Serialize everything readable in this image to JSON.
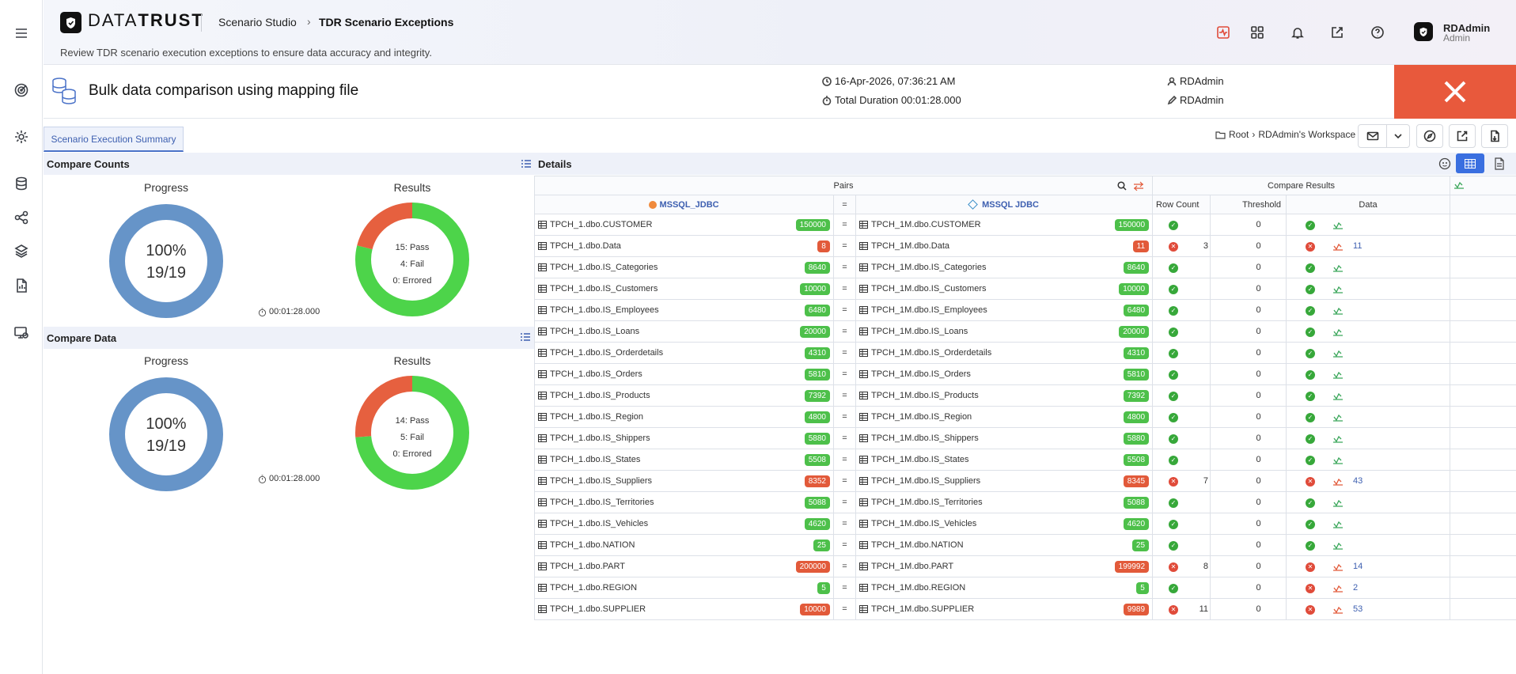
{
  "app": {
    "brand_light": "DATA",
    "brand_bold": "TRUST",
    "breadcrumb": [
      "Scenario Studio",
      "TDR Scenario Exceptions"
    ],
    "subtitle": "Review TDR scenario execution exceptions to ensure data accuracy and integrity.",
    "user": {
      "name": "RDAdmin",
      "role": "Admin"
    }
  },
  "rail_icons": [
    "menu-icon",
    "target-icon",
    "settings-icon",
    "database-icon",
    "workflow-icon",
    "layers-icon",
    "report-icon",
    "monitor-icon"
  ],
  "scenario": {
    "title": "Bulk data comparison using mapping file",
    "datetime": "16-Apr-2026, 07:36:21 AM",
    "duration": "Total Duration 00:01:28.000",
    "run_by": "RDAdmin",
    "edited_by": "RDAdmin",
    "status_color": "#e8593c"
  },
  "tab": {
    "label": "Scenario Execution Summary"
  },
  "workspace": {
    "root": "Root",
    "name": "RDAdmin's Workspace"
  },
  "compare_counts": {
    "title": "Compare Counts",
    "progress_label": "Progress",
    "results_label": "Results",
    "percent": "100%",
    "ratio": "19/19",
    "pass": "15: Pass",
    "fail": "4: Fail",
    "errored": "0: Errored",
    "pass_n": 15,
    "fail_n": 4,
    "err_n": 0,
    "duration": "00:01:28.000"
  },
  "compare_data": {
    "title": "Compare Data",
    "progress_label": "Progress",
    "results_label": "Results",
    "percent": "100%",
    "ratio": "19/19",
    "pass": "14: Pass",
    "fail": "5: Fail",
    "errored": "0: Errored",
    "pass_n": 14,
    "fail_n": 5,
    "err_n": 0,
    "duration": "00:01:28.000"
  },
  "details": {
    "title": "Details",
    "pairs_label": "Pairs",
    "compare_results_label": "Compare Results",
    "source_label": "MSSQL_JDBC",
    "target_label": "MSSQL JDBC",
    "eq_label": "=",
    "col_row_count": "Row Count",
    "col_threshold": "Threshold",
    "col_data": "Data",
    "rows": [
      {
        "src": "TPCH_1.dbo.CUSTOMER",
        "src_count": "150000",
        "src_ok": true,
        "tgt": "TPCH_1M.dbo.CUSTOMER",
        "tgt_count": "150000",
        "tgt_ok": true,
        "row_ok": true,
        "row_diff": "",
        "threshold": "0",
        "data_ok": true,
        "data_diff": ""
      },
      {
        "src": "TPCH_1.dbo.Data",
        "src_count": "8",
        "src_ok": false,
        "tgt": "TPCH_1M.dbo.Data",
        "tgt_count": "11",
        "tgt_ok": false,
        "row_ok": false,
        "row_diff": "3",
        "threshold": "0",
        "data_ok": false,
        "data_diff": "11"
      },
      {
        "src": "TPCH_1.dbo.IS_Categories",
        "src_count": "8640",
        "src_ok": true,
        "tgt": "TPCH_1M.dbo.IS_Categories",
        "tgt_count": "8640",
        "tgt_ok": true,
        "row_ok": true,
        "row_diff": "",
        "threshold": "0",
        "data_ok": true,
        "data_diff": ""
      },
      {
        "src": "TPCH_1.dbo.IS_Customers",
        "src_count": "10000",
        "src_ok": true,
        "tgt": "TPCH_1M.dbo.IS_Customers",
        "tgt_count": "10000",
        "tgt_ok": true,
        "row_ok": true,
        "row_diff": "",
        "threshold": "0",
        "data_ok": true,
        "data_diff": ""
      },
      {
        "src": "TPCH_1.dbo.IS_Employees",
        "src_count": "6480",
        "src_ok": true,
        "tgt": "TPCH_1M.dbo.IS_Employees",
        "tgt_count": "6480",
        "tgt_ok": true,
        "row_ok": true,
        "row_diff": "",
        "threshold": "0",
        "data_ok": true,
        "data_diff": ""
      },
      {
        "src": "TPCH_1.dbo.IS_Loans",
        "src_count": "20000",
        "src_ok": true,
        "tgt": "TPCH_1M.dbo.IS_Loans",
        "tgt_count": "20000",
        "tgt_ok": true,
        "row_ok": true,
        "row_diff": "",
        "threshold": "0",
        "data_ok": true,
        "data_diff": ""
      },
      {
        "src": "TPCH_1.dbo.IS_Orderdetails",
        "src_count": "4310",
        "src_ok": true,
        "tgt": "TPCH_1M.dbo.IS_Orderdetails",
        "tgt_count": "4310",
        "tgt_ok": true,
        "row_ok": true,
        "row_diff": "",
        "threshold": "0",
        "data_ok": true,
        "data_diff": ""
      },
      {
        "src": "TPCH_1.dbo.IS_Orders",
        "src_count": "5810",
        "src_ok": true,
        "tgt": "TPCH_1M.dbo.IS_Orders",
        "tgt_count": "5810",
        "tgt_ok": true,
        "row_ok": true,
        "row_diff": "",
        "threshold": "0",
        "data_ok": true,
        "data_diff": ""
      },
      {
        "src": "TPCH_1.dbo.IS_Products",
        "src_count": "7392",
        "src_ok": true,
        "tgt": "TPCH_1M.dbo.IS_Products",
        "tgt_count": "7392",
        "tgt_ok": true,
        "row_ok": true,
        "row_diff": "",
        "threshold": "0",
        "data_ok": true,
        "data_diff": ""
      },
      {
        "src": "TPCH_1.dbo.IS_Region",
        "src_count": "4800",
        "src_ok": true,
        "tgt": "TPCH_1M.dbo.IS_Region",
        "tgt_count": "4800",
        "tgt_ok": true,
        "row_ok": true,
        "row_diff": "",
        "threshold": "0",
        "data_ok": true,
        "data_diff": ""
      },
      {
        "src": "TPCH_1.dbo.IS_Shippers",
        "src_count": "5880",
        "src_ok": true,
        "tgt": "TPCH_1M.dbo.IS_Shippers",
        "tgt_count": "5880",
        "tgt_ok": true,
        "row_ok": true,
        "row_diff": "",
        "threshold": "0",
        "data_ok": true,
        "data_diff": ""
      },
      {
        "src": "TPCH_1.dbo.IS_States",
        "src_count": "5508",
        "src_ok": true,
        "tgt": "TPCH_1M.dbo.IS_States",
        "tgt_count": "5508",
        "tgt_ok": true,
        "row_ok": true,
        "row_diff": "",
        "threshold": "0",
        "data_ok": true,
        "data_diff": ""
      },
      {
        "src": "TPCH_1.dbo.IS_Suppliers",
        "src_count": "8352",
        "src_ok": false,
        "tgt": "TPCH_1M.dbo.IS_Suppliers",
        "tgt_count": "8345",
        "tgt_ok": false,
        "row_ok": false,
        "row_diff": "7",
        "threshold": "0",
        "data_ok": false,
        "data_diff": "43"
      },
      {
        "src": "TPCH_1.dbo.IS_Territories",
        "src_count": "5088",
        "src_ok": true,
        "tgt": "TPCH_1M.dbo.IS_Territories",
        "tgt_count": "5088",
        "tgt_ok": true,
        "row_ok": true,
        "row_diff": "",
        "threshold": "0",
        "data_ok": true,
        "data_diff": ""
      },
      {
        "src": "TPCH_1.dbo.IS_Vehicles",
        "src_count": "4620",
        "src_ok": true,
        "tgt": "TPCH_1M.dbo.IS_Vehicles",
        "tgt_count": "4620",
        "tgt_ok": true,
        "row_ok": true,
        "row_diff": "",
        "threshold": "0",
        "data_ok": true,
        "data_diff": ""
      },
      {
        "src": "TPCH_1.dbo.NATION",
        "src_count": "25",
        "src_ok": true,
        "tgt": "TPCH_1M.dbo.NATION",
        "tgt_count": "25",
        "tgt_ok": true,
        "row_ok": true,
        "row_diff": "",
        "threshold": "0",
        "data_ok": true,
        "data_diff": ""
      },
      {
        "src": "TPCH_1.dbo.PART",
        "src_count": "200000",
        "src_ok": false,
        "tgt": "TPCH_1M.dbo.PART",
        "tgt_count": "199992",
        "tgt_ok": false,
        "row_ok": false,
        "row_diff": "8",
        "threshold": "0",
        "data_ok": false,
        "data_diff": "14"
      },
      {
        "src": "TPCH_1.dbo.REGION",
        "src_count": "5",
        "src_ok": true,
        "tgt": "TPCH_1M.dbo.REGION",
        "tgt_count": "5",
        "tgt_ok": true,
        "row_ok": true,
        "row_diff": "",
        "threshold": "0",
        "data_ok": false,
        "data_diff": "2"
      },
      {
        "src": "TPCH_1.dbo.SUPPLIER",
        "src_count": "10000",
        "src_ok": false,
        "tgt": "TPCH_1M.dbo.SUPPLIER",
        "tgt_count": "9989",
        "tgt_ok": false,
        "row_ok": false,
        "row_diff": "11",
        "threshold": "0",
        "data_ok": false,
        "data_diff": "53"
      }
    ]
  },
  "colors": {
    "pass": "#4dd44a",
    "fail": "#e6603f",
    "progress": "#6694c8",
    "accent": "#3d5fb0"
  }
}
